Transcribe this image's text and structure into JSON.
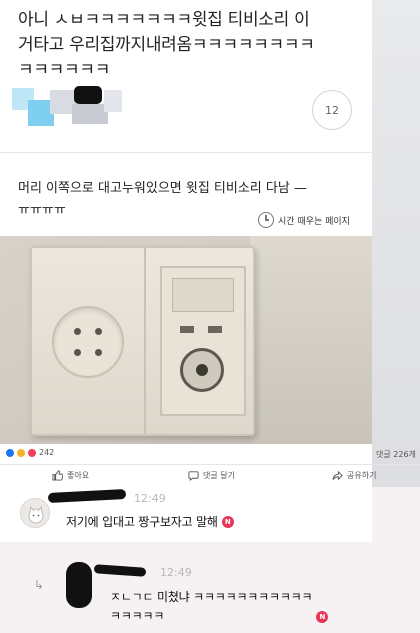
{
  "post": {
    "text": "아니 ㅅㅂㅋㅋㅋㅋㅋㅋㅋ윗집 티비소리 이\n거타고 우리집까지내려옴ㅋㅋㅋㅋㅋㅋㅋㅋ\nㅋㅋㅋㅋㅋㅋ",
    "comment_count": "12"
  },
  "second_post": {
    "text": "머리 이쪽으로 대고누워있으면 윗집 티비소리 다남 —\nㅠㅠㅠㅠ",
    "time_label": "시간 때우는 페이지"
  },
  "footer": {
    "reaction_count": "242",
    "comment_total": "댓글 226개",
    "like_label": "좋아요",
    "comment_label": "댓글 달기",
    "share_label": "공유하기"
  },
  "comments": [
    {
      "time": "12:49",
      "text": "저기에 입대고 짱구보자고 말해",
      "badge": "N"
    },
    {
      "time": "12:49",
      "text": "ㅈㄴㄱㄷ 미쳤냐 ㅋㅋㅋㅋㅋㅋㅋㅋㅋㅋㅋ\nㅋㅋㅋㅋㅋ",
      "badge": "N"
    }
  ],
  "colors": {
    "new_badge": "#e8385a",
    "like": "#1877f2",
    "haha": "#f7b125",
    "love": "#f33e58"
  },
  "icons": {
    "time": "clock-icon",
    "like": "thumbs-up-icon",
    "comment": "speech-bubble-icon",
    "share": "share-arrow-icon",
    "reply": "reply-arrow-icon"
  }
}
